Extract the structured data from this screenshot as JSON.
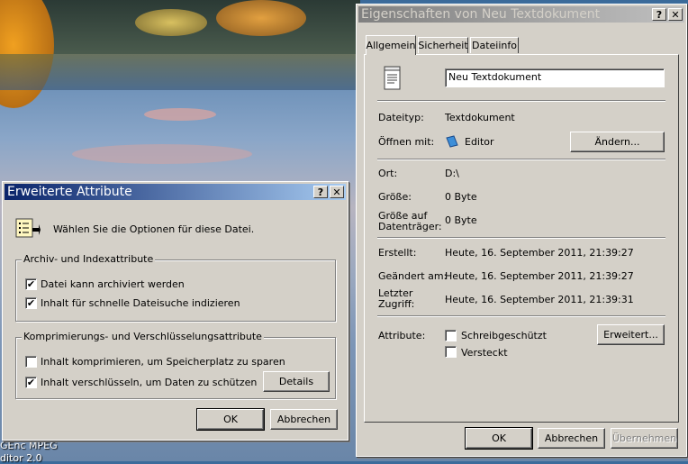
{
  "desktop": {
    "icon_labels": [
      "GEnc MPEG",
      "ditor 2.0"
    ]
  },
  "extended": {
    "title": "Erweiterte Attribute",
    "help": "?",
    "close": "✕",
    "intro": "Wählen Sie die Optionen für diese Datei.",
    "group1": {
      "legend": "Archiv- und Indexattribute",
      "items": [
        {
          "label": "Datei kann archiviert werden",
          "checked": "✔"
        },
        {
          "label": "Inhalt für schnelle Dateisuche indizieren",
          "checked": "✔"
        }
      ]
    },
    "group2": {
      "legend": "Komprimierungs- und Verschlüsselungsattribute",
      "items": [
        {
          "label": "Inhalt komprimieren, um Speicherplatz zu sparen",
          "checked": ""
        },
        {
          "label": "Inhalt verschlüsseln, um Daten zu schützen",
          "checked": "✔"
        }
      ],
      "details": "Details"
    },
    "ok": "OK",
    "cancel": "Abbrechen"
  },
  "props": {
    "title": "Eigenschaften von Neu Textdokument",
    "help": "?",
    "close": "✕",
    "tabs": [
      "Allgemein",
      "Sicherheit",
      "Dateiinfo"
    ],
    "filename": "Neu Textdokument",
    "rows": {
      "type_label": "Dateityp:",
      "type_value": "Textdokument",
      "open_label": "Öffnen mit:",
      "open_value": "Editor",
      "change": "Ändern...",
      "loc_label": "Ort:",
      "loc_value": "D:\\",
      "size_label": "Größe:",
      "size_value": "0 Byte",
      "disk_label_1": "Größe auf",
      "disk_label_2": "Datenträger:",
      "disk_value": "0 Byte",
      "created_label": "Erstellt:",
      "created_value": "Heute, 16. September 2011, 21:39:27",
      "modified_label": "Geändert am:",
      "modified_value": "Heute, 16. September 2011, 21:39:27",
      "access_label_1": "Letzter",
      "access_label_2": "Zugriff:",
      "access_value": "Heute, 16. September 2011, 21:39:31",
      "attr_label": "Attribute:",
      "readonly": "Schreibgeschützt",
      "hidden": "Versteckt",
      "advanced": "Erweitert..."
    },
    "ok": "OK",
    "cancel": "Abbrechen",
    "apply": "Übernehmen"
  }
}
